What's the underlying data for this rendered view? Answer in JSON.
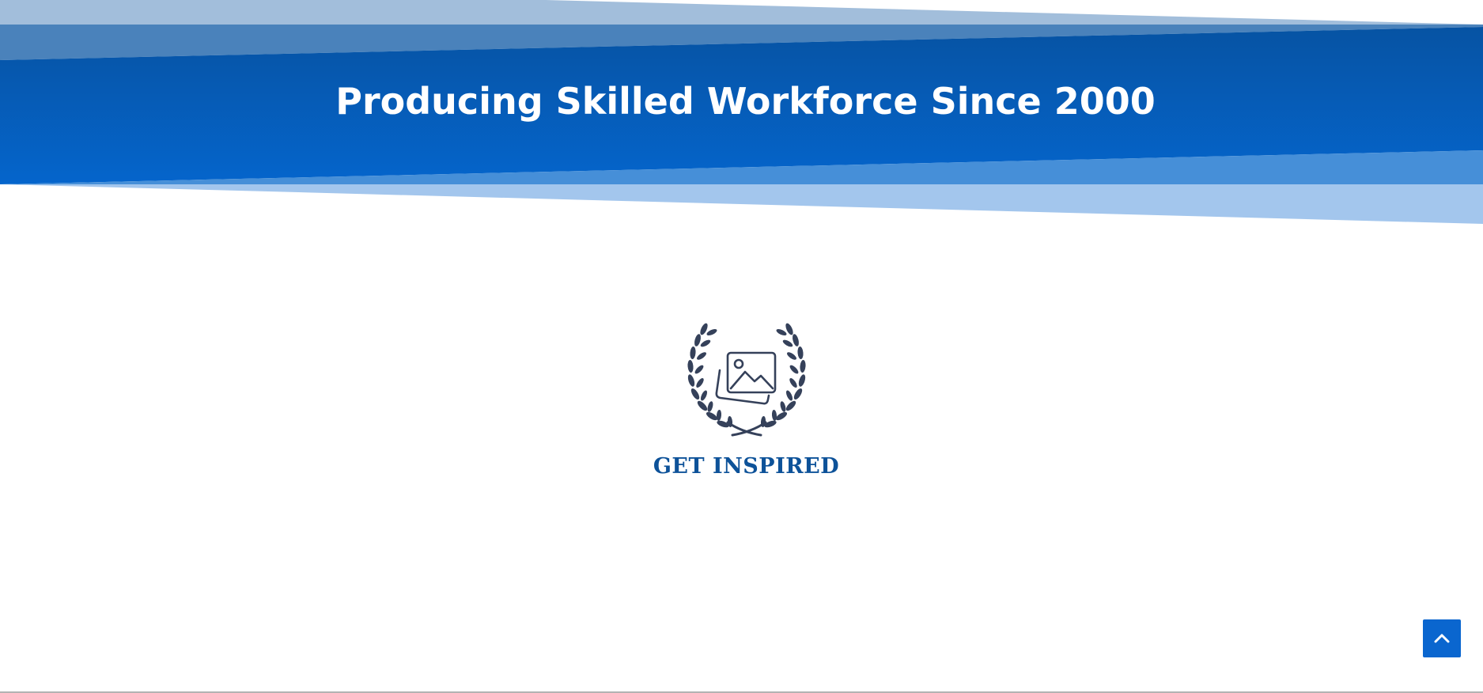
{
  "hero": {
    "title": "Producing Skilled Workforce Since 2000"
  },
  "badge": {
    "icon": "laurel-image-icon",
    "caption": "GET INSPIRED"
  },
  "scroll_top": {
    "icon": "chevron-up-icon"
  },
  "colors": {
    "hero_dark": "#0656a9",
    "hero_light_band": "#4b8fd6",
    "hero_pale_band": "#a3c6ec",
    "caption": "#0d5299",
    "badge_icon": "#35415a",
    "button": "#0a66cf"
  }
}
